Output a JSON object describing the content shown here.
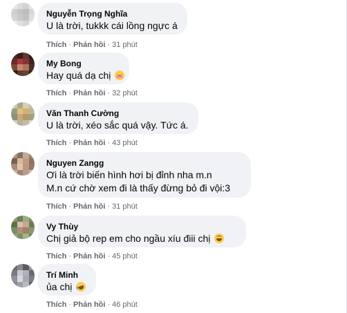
{
  "labels": {
    "like": "Thích",
    "reply": "Phản hồi",
    "separator": "·"
  },
  "comments": [
    {
      "author": "Nguyễn Trọng Nghĩa",
      "lines": [
        "U là trời, tukkk cái lồng ngực á"
      ],
      "time": "31 phút",
      "avatar_colors": [
        "#e8e8e8",
        "#dcdcdc",
        "#d2d2d2",
        "#e6e6e6",
        "#cfcfcf",
        "#c4c4c4",
        "#bdbdbd",
        "#d8d8d8",
        "#d4d4d4",
        "#c9c9c9",
        "#c2c2c2",
        "#dedede",
        "#ececec",
        "#e0e0e0",
        "#d6d6d6",
        "#eeeeee"
      ]
    },
    {
      "author": "My Bong",
      "lines": [
        "Hay quá dạ chị"
      ],
      "emoji": "smiling-face-with-blush-icon",
      "time": "32 phút",
      "avatar_colors": [
        "#4a2a22",
        "#3a1d18",
        "#5c3a2e",
        "#2f1a16",
        "#6b2a2a",
        "#a23b3b",
        "#8d3030",
        "#3d2420",
        "#7a4a3a",
        "#c48a6a",
        "#b0735a",
        "#4b2e26",
        "#2a1612",
        "#5e3a30",
        "#6a4236",
        "#33201a"
      ]
    },
    {
      "author": "Văn Thanh Cường",
      "lines": [
        "U là trời, xéo sắc quá vậy. Tức á."
      ],
      "time": "43 phút",
      "avatar_colors": [
        "#c9c9b0",
        "#a8a890",
        "#d6d0b6",
        "#bfbfa6",
        "#9a9a80",
        "#e0c080",
        "#d4b070",
        "#b8b89c",
        "#8f8f78",
        "#c8a878",
        "#b89868",
        "#a0a088",
        "#d0d0bc",
        "#b4b49c",
        "#c0c0a8",
        "#dcdcc8"
      ]
    },
    {
      "author": "Nguyen Zangg",
      "lines": [
        "Ơi là trời biến hình hơi bị đỉnh nha m.n",
        "M.n cứ chờ xem đi là thấy đừng bỏ đi vội:3"
      ],
      "time": "31 phút",
      "avatar_colors": [
        "#b09080",
        "#8a7064",
        "#c4a898",
        "#9c8070",
        "#7a5e50",
        "#d8b8a0",
        "#c09c84",
        "#8e7262",
        "#a88a78",
        "#e0c4ac",
        "#b8987e",
        "#96786a",
        "#c8b0a0",
        "#a08474",
        "#b89c8c",
        "#d0b8a8"
      ]
    },
    {
      "author": "Vy Thùy",
      "lines": [
        "Chị giả bộ rep em cho ngầu xíu điii chị"
      ],
      "emoji": "smiling-face-icon",
      "time": "45 phút",
      "avatar_colors": [
        "#8a9a70",
        "#6e8058",
        "#9cac84",
        "#7a8c62",
        "#5e7048",
        "#d8c0a8",
        "#c8a890",
        "#6a7c54",
        "#7c8e66",
        "#b09078",
        "#a08068",
        "#88986e",
        "#94a47c",
        "#808e68",
        "#a4b28a",
        "#70825a"
      ]
    },
    {
      "author": "Trí Minh",
      "lines": [
        "ủa chị"
      ],
      "emoji": "rolling-laughing-icon",
      "time": "46 phút",
      "avatar_colors": [
        "#6a6a72",
        "#8a8a92",
        "#5a5a62",
        "#9a9aa2",
        "#7a7a82",
        "#c8c8d0",
        "#b0b0b8",
        "#68686e",
        "#9090a0",
        "#d8d8e0",
        "#a8a8b0",
        "#7c7c84",
        "#88888e",
        "#a0a0a8",
        "#b8b8c0",
        "#606068"
      ]
    }
  ]
}
